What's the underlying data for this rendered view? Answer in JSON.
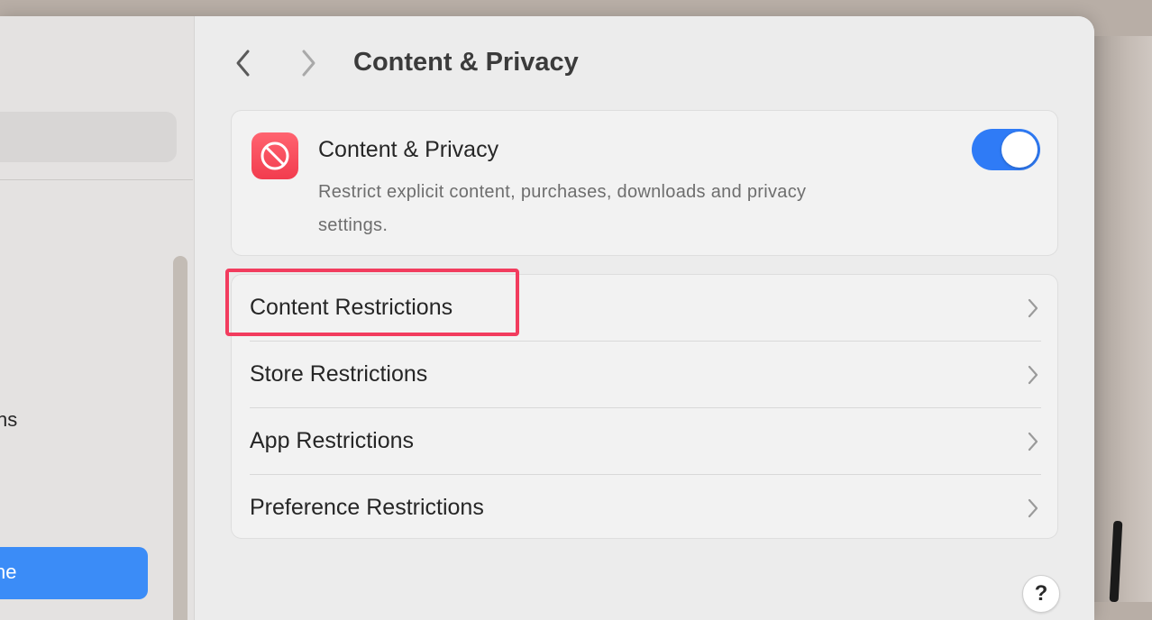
{
  "sidebar": {
    "partial_item_text": "ns",
    "selected_item_text": "ne"
  },
  "header": {
    "title": "Content & Privacy",
    "back_icon": "chevron-left-icon",
    "forward_icon": "chevron-right-icon"
  },
  "feature": {
    "icon": "prohibited-icon",
    "title": "Content & Privacy",
    "description": "Restrict explicit content, purchases, downloads and privacy settings.",
    "enabled": true,
    "accent_color": "#2f7bf6"
  },
  "list": {
    "items": [
      {
        "label": "Content Restrictions"
      },
      {
        "label": "Store Restrictions"
      },
      {
        "label": "App Restrictions"
      },
      {
        "label": "Preference Restrictions"
      }
    ]
  },
  "annotation": {
    "highlight_color": "#f23c5e",
    "highlighted_item": "Content Restrictions"
  },
  "help": {
    "label": "?"
  }
}
